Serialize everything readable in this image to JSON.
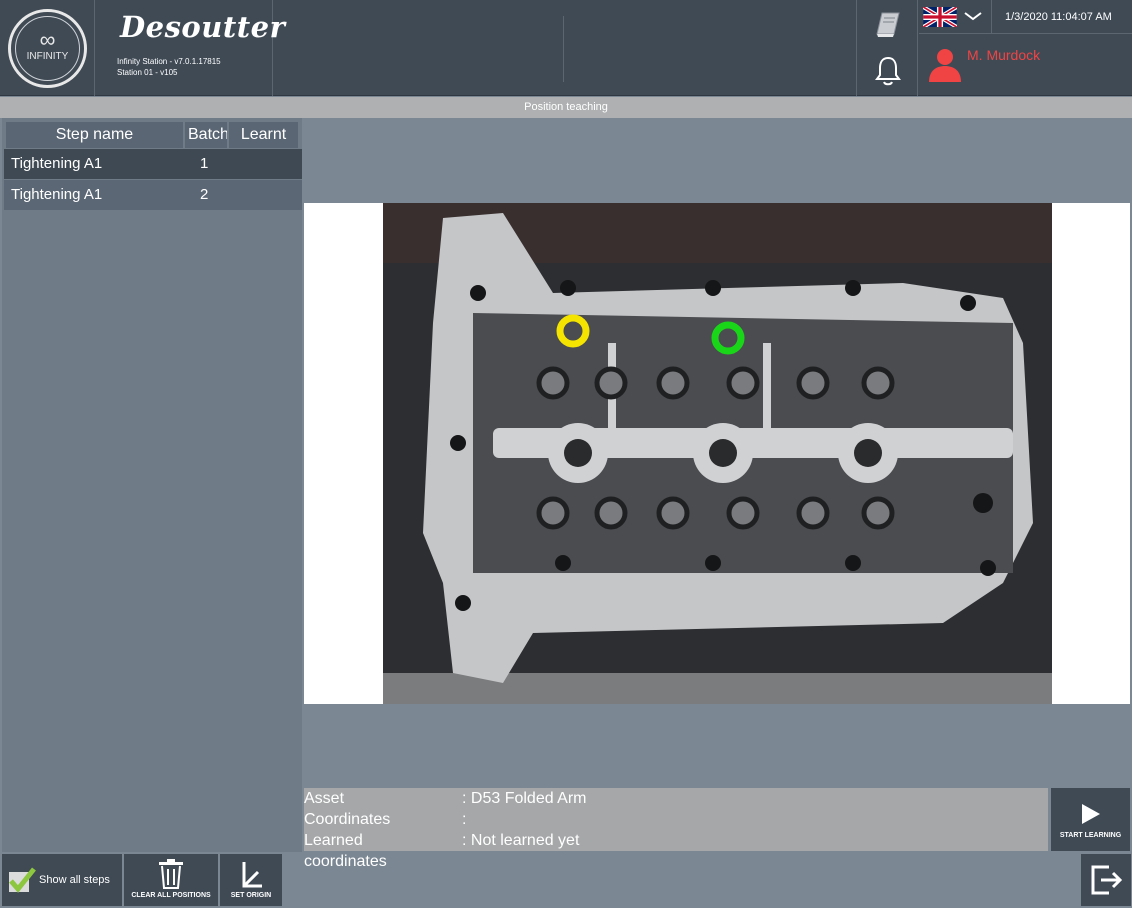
{
  "header": {
    "logo_text": "INFINITY",
    "brand": "Desoutter",
    "version": "Infinity Station - v7.0.1.17815",
    "station": "Station 01 - v105",
    "datetime": "1/3/2020 11:04:07 AM",
    "user_name": "M. Murdock",
    "language_flag": "uk-flag-icon",
    "icons": [
      "book-icon",
      "bell-icon",
      "chevron-down-icon",
      "user-icon"
    ]
  },
  "title": "Position teaching",
  "steps_table": {
    "columns": [
      "Step name",
      "Batch",
      "Learnt"
    ],
    "rows": [
      {
        "name": "Tightening A1",
        "batch": "1",
        "learnt": ""
      },
      {
        "name": "Tightening A1",
        "batch": "2",
        "learnt": ""
      }
    ]
  },
  "info": {
    "asset_label": "Asset",
    "asset_value": ": D53 Folded Arm",
    "coords_label": "Coordinates",
    "coords_value": ":",
    "learned_label": "Learned coordinates",
    "learned_value": ": Not learned yet"
  },
  "buttons": {
    "start_learning": "START LEARNING",
    "show_all_steps": "Show all steps",
    "clear_all_positions": "CLEAR ALL POSITIONS",
    "set_origin": "SET ORIGIN"
  },
  "markers": [
    {
      "color": "#f4e400",
      "label": "marker-yellow"
    },
    {
      "color": "#19d619",
      "label": "marker-green"
    }
  ],
  "colors": {
    "header_bg": "#3f4a55",
    "panel_bg": "#7b8793",
    "user_accent": "#f04444",
    "check_green": "#8dc63f"
  }
}
